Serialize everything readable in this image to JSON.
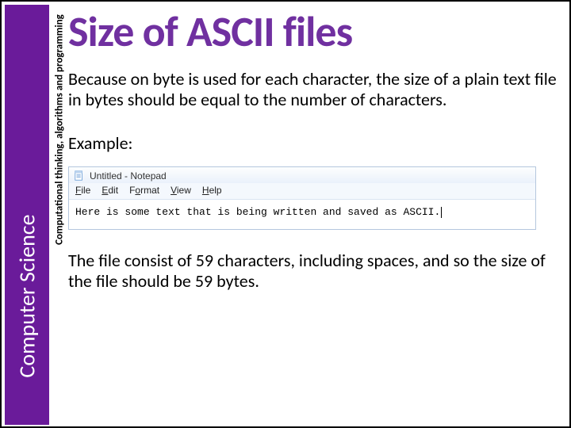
{
  "sidebar": {
    "main_label": "Computer Science",
    "sub_label": "Computational thinking, algorithms and programming"
  },
  "title": "Size of ASCII files",
  "paragraph1": "Because on byte is used for each character, the size of a plain text file in bytes should be equal to the number of characters.",
  "example_label": "Example:",
  "notepad": {
    "window_title": "Untitled - Notepad",
    "menu": {
      "file": "File",
      "edit": "Edit",
      "format": "Format",
      "view": "View",
      "help": "Help"
    },
    "body_text": "Here is some text that is being written and saved as ASCII."
  },
  "paragraph2": "The file consist of 59 characters, including spaces, and so the size of the file should be 59 bytes."
}
